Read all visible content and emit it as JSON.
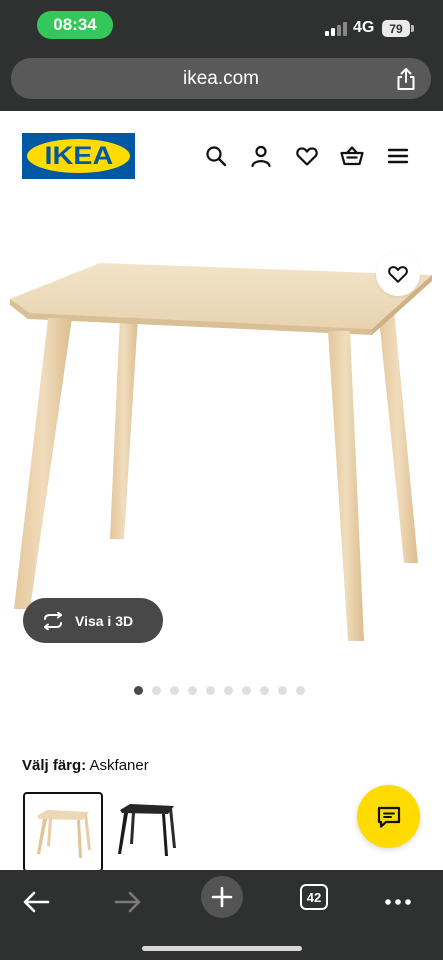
{
  "status_bar": {
    "time": "08:34",
    "network": "4G",
    "battery": "79"
  },
  "browser": {
    "url": "ikea.com",
    "tab_count": "42"
  },
  "site": {
    "logo_text": "IKEA",
    "header_icons": [
      "search-icon",
      "account-icon",
      "heart-icon",
      "basket-icon",
      "menu-icon"
    ],
    "brand_colors": {
      "blue": "#0058a3",
      "yellow": "#ffdb00"
    }
  },
  "product": {
    "view_3d_label": "Visa i 3D",
    "image_count": 10,
    "active_image_index": 0,
    "color_label": "Välj färg:",
    "selected_color": "Askfaner",
    "color_options": [
      "ash veneer (selected)",
      "black"
    ]
  },
  "colors": {
    "chrome_dark": "#2f3030",
    "status_green": "#34c759",
    "chat_yellow": "#ffdb00"
  }
}
